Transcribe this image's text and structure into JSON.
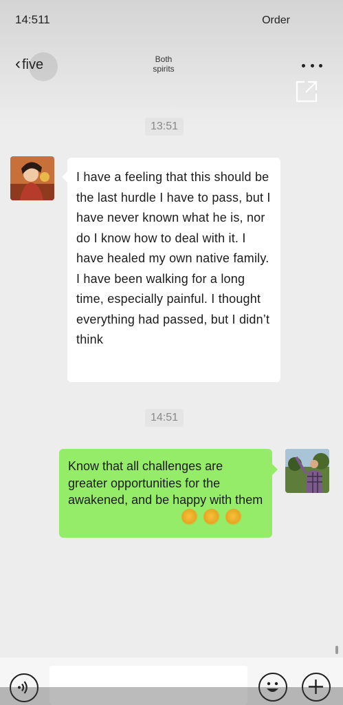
{
  "status_bar": {
    "time": "14:511",
    "right_text": "Order"
  },
  "nav": {
    "back_chevron": "‹",
    "back_label": "five",
    "title_line1": "Both",
    "title_line2": "spirits",
    "more_icon": "more-dots-icon",
    "share_icon": "share-external-icon"
  },
  "messages": [
    {
      "timestamp": "13:51",
      "sender": "other",
      "text": "I have a feeling that this should be the last hurdle I have to pass, but I have never known what he is, nor do I know how to deal with it. I have healed my own native family. I have been walking for a long time, especially painful. I thought everything had passed, but I didn’t think"
    },
    {
      "timestamp": "14:51",
      "sender": "me",
      "text": "Know that all challenges are greater opportunities for the awakened, and be happy with them",
      "emojis": [
        "thumbs-up",
        "thumbs-up",
        "thumbs-up"
      ]
    }
  ],
  "input_bar": {
    "voice_icon": "voice-icon",
    "emoji_icon": "emoji-smiley-icon",
    "plus_icon": "plus-icon"
  },
  "colors": {
    "page_background": "#ededed",
    "incoming_bubble": "#ffffff",
    "outgoing_bubble": "#95ec69"
  }
}
